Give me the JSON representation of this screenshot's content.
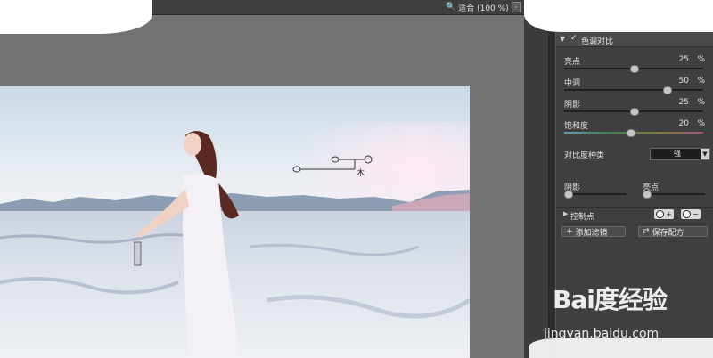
{
  "toolbar": {
    "zoom_label": "适合 (100 %)",
    "zoom_btn": "›"
  },
  "panel": {
    "title": "色调对比",
    "check": "✓",
    "arrow": "▼",
    "sliders": [
      {
        "label": "亮点",
        "value": "25",
        "unit": "%",
        "level": 0.5
      },
      {
        "label": "中调",
        "value": "50",
        "unit": "%",
        "level": 0.75
      },
      {
        "label": "阴影",
        "value": "25",
        "unit": "%",
        "level": 0.5
      },
      {
        "label": "饱和度",
        "value": "20",
        "unit": "%",
        "level": 0.47
      }
    ],
    "contrast_type": {
      "label": "对比度种类",
      "value": "强",
      "button": "▼"
    },
    "mini_sliders": [
      {
        "label": "阴影"
      },
      {
        "label": "亮点"
      }
    ],
    "control_points": {
      "label": "控制点",
      "arrow": "▶",
      "add_sign": "+",
      "remove_sign": "−"
    },
    "actions": [
      {
        "label": "添加滤镜",
        "icon": "+"
      },
      {
        "label": "保存配方",
        "icon": "⇄"
      }
    ]
  },
  "control_point_overlay": {
    "label": "木"
  },
  "watermark": {
    "logo": "Bai度经验",
    "url": "jingyan.baidu.com"
  },
  "colors": {
    "panel_bg": "#3f3f3f",
    "canvas_bg": "#727272",
    "toolbar_bg": "#3e3e3e"
  },
  "icons": {
    "zoom": "magnifier-icon",
    "add_cp": "add-control-point-icon",
    "remove_cp": "remove-control-point-icon"
  }
}
